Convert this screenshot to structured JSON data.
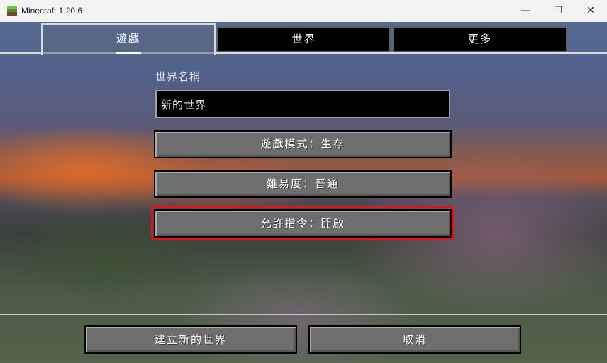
{
  "window": {
    "title": "Minecraft 1.20.6",
    "controls": {
      "minimize": "—",
      "maximize": "☐",
      "close": "✕"
    }
  },
  "tabs": [
    {
      "label": "遊戲",
      "active": true
    },
    {
      "label": "世界",
      "active": false
    },
    {
      "label": "更多",
      "active": false
    }
  ],
  "world_name": {
    "label": "世界名稱",
    "value": "新的世界"
  },
  "options": {
    "game_mode": "遊戲模式：生存",
    "difficulty": "難易度：普通",
    "allow_cheats": "允許指令：開啟"
  },
  "actions": {
    "create": "建立新的世界",
    "cancel": "取消"
  },
  "colors": {
    "highlight": "#e8101a"
  }
}
